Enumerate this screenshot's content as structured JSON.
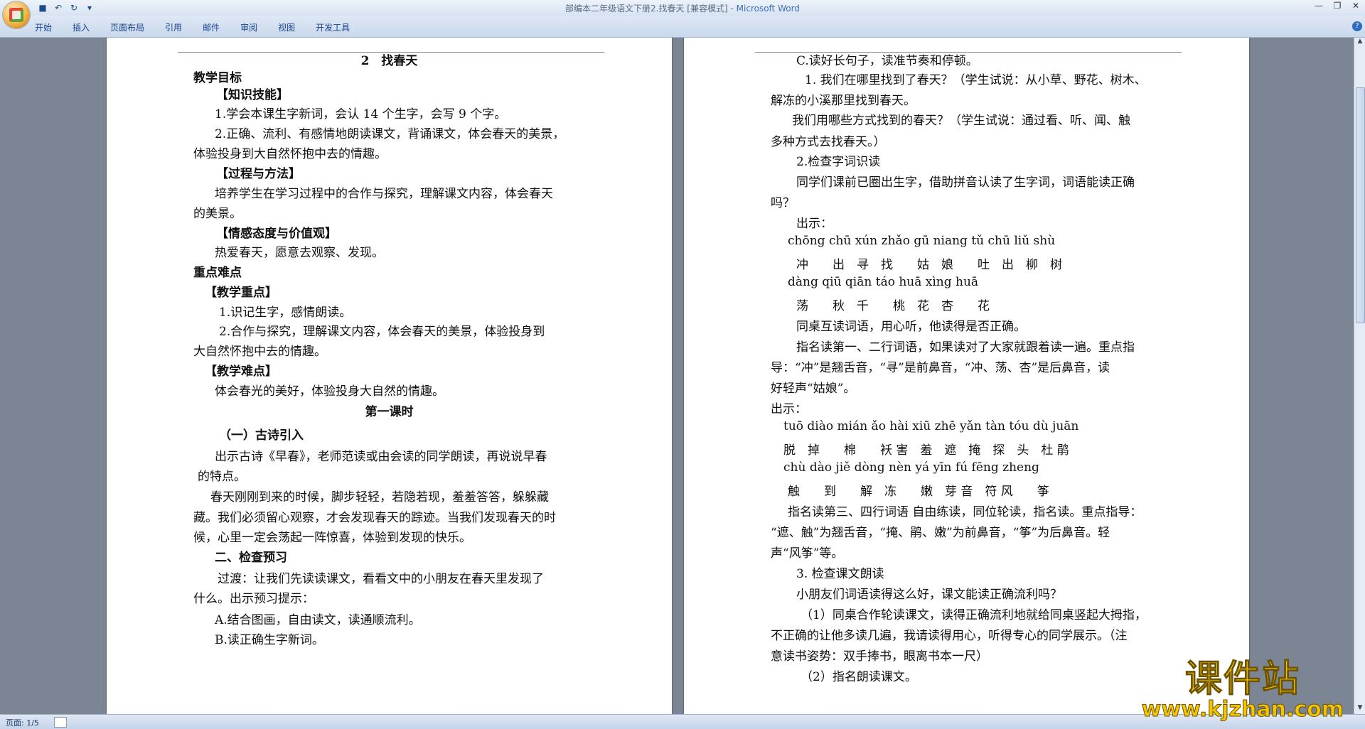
{
  "window": {
    "title_doc": "部编本二年级语文下册2.找春天 [兼容模式] -",
    "title_app": "Microsoft Word"
  },
  "quick_access": {
    "save_icon": "save-icon",
    "undo_icon": "undo-icon",
    "redo_icon": "redo-icon"
  },
  "ribbon_tabs": [
    "开始",
    "插入",
    "页面布局",
    "引用",
    "邮件",
    "审阅",
    "视图",
    "开发工具"
  ],
  "page1": [
    "2　找春天",
    "教学目标",
    "【知识技能】",
    "1.学会本课生字新词，会认 14 个生字，会写 9 个字。",
    "2.正确、流利、有感情地朗读课文，背诵课文，体会春天的美景，",
    "体验投身到大自然怀抱中去的情趣。",
    "【过程与方法】",
    "培养学生在学习过程中的合作与探究，理解课文内容，体会春天",
    "的美景。",
    "【情感态度与价值观】",
    "热爱春天，愿意去观察、发现。",
    "重点难点",
    "【教学重点】",
    "1.识记生字，感情朗读。",
    "2.合作与探究，理解课文内容，体会春天的美景，体验投身到",
    "大自然怀抱中去的情趣。",
    "【教学难点】",
    "体会春光的美好，体验投身大自然的情趣。",
    "第一课时",
    "（一）古诗引入",
    "出示古诗《早春》，老师范读或由会读的同学朗读，再说说早春",
    "的特点。",
    "春天刚刚到来的时候，脚步轻轻，若隐若现，羞羞答答，躲躲藏",
    "藏。我们必须留心观察，才会发现春天的踪迹。当我们发现春天的时",
    "候，心里一定会荡起一阵惊喜，体验到发现的快乐。",
    "二、检查预习",
    "过渡：让我们先读读课文，看看文中的小朋友在春天里发现了",
    "什么。出示预习提示：",
    "A.结合图画，自由读文，读通顺流利。",
    "B.读正确生字新词。"
  ],
  "page2": [
    "C.读好长句子，读准节奏和停顿。",
    "1. 我们在哪里找到了春天？（学生试说：从小草、野花、树木、",
    "解冻的小溪那里找到春天。",
    "我们用哪些方式找到的春天？（学生试说：通过看、听、闻、触",
    "多种方式去找春天。）",
    "2.检查字词识读",
    "同学们课前已圈出生字，借助拼音认读了生字词，词语能读正确",
    "吗？",
    "出示：",
    "chōng chū xún zhǎo gū niang tǔ chū liǔ shù",
    "冲　　出　寻　找　　姑　娘　　吐　出　柳　树",
    "dàng qiū qiān táo huā xìng huā",
    "荡　　秋　千　　桃　花　杏　　花",
    "同桌互读词语，用心听，他读得是否正确。",
    "指名读第一、二行词语，如果读对了大家就跟着读一遍。重点指",
    "导：“冲”是翘舌音，“寻”是前鼻音，“冲、荡、杏”是后鼻音，读",
    "好轻声“姑娘”。",
    "出示：",
    "tuō diào mián ǎo hài xiū zhē yǎn tàn tóu dù juān",
    "脱　掉　　棉　　袄 害　羞　遮　掩　探　头　杜 鹃",
    "chù dào jiě dòng nèn yá yīn fú fēng zheng",
    "触　　到　　解　冻　　嫩　芽 音　符 风　　筝",
    "指名读第三、四行词语 自由练读，同位轮读，指名读。重点指导：",
    "“遮、触”为翘舌音，“掩、鹃、嫩”为前鼻音，“筝”为后鼻音。轻",
    "声“风筝”等。",
    "3. 检查课文朗读",
    "小朋友们词语读得这么好，课文能读正确流利吗？",
    "（1）同桌合作轮读课文，读得正确流利地就给同桌竖起大拇指，",
    "不正确的让他多读几遍，我请读得用心，听得专心的同学展示。（注",
    "意读书姿势：双手捧书，眼离书本一尺）",
    "（2）指名朗读课文。"
  ],
  "status": {
    "page": "页面: 1/5"
  },
  "watermark": {
    "line1": "课件站",
    "line2": "www.kjzhan.com"
  }
}
